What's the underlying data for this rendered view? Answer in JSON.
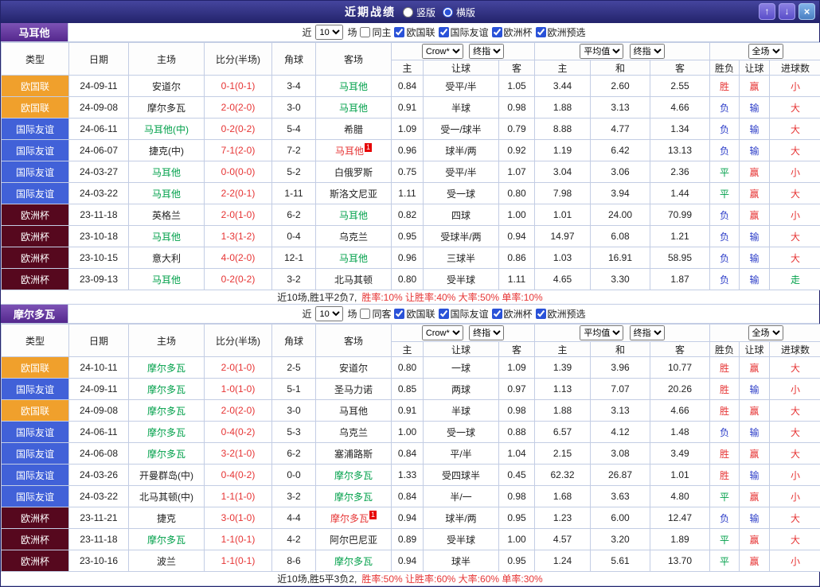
{
  "titlebar": {
    "title": "近期战绩",
    "layout_options": [
      {
        "label": "竖版",
        "selected": false
      },
      {
        "label": "横版",
        "selected": true
      }
    ],
    "up_icon": "↑",
    "down_icon": "↓",
    "close_icon": "×"
  },
  "table_header": {
    "type": "类型",
    "date": "日期",
    "home": "主场",
    "score": "比分(半场)",
    "corner": "角球",
    "away": "客场",
    "company": "Crow*",
    "final_index": "终指",
    "average": "平均值",
    "full_match": "全场",
    "sub": {
      "h": "主",
      "handicap": "让球",
      "a": "客",
      "avg_h": "主",
      "avg_d": "和",
      "avg_a": "客",
      "wdl": "胜负",
      "cover": "让球",
      "goals": "进球数"
    }
  },
  "league_colors": {
    "欧国联": "#f0a02c",
    "国际友谊": "#4161d8",
    "欧洲杯": "#56081e"
  },
  "sections": [
    {
      "team": "马耳他",
      "filter": {
        "prefix": "近",
        "count": "10",
        "suffix": "场",
        "venue": {
          "label": "同主",
          "checked": false
        },
        "leagues": [
          {
            "label": "欧国联",
            "checked": true
          },
          {
            "label": "国际友谊",
            "checked": true
          },
          {
            "label": "欧洲杯",
            "checked": true
          },
          {
            "label": "欧洲预选",
            "checked": true
          }
        ]
      },
      "rows": [
        {
          "type": "欧国联",
          "date": "24-09-11",
          "home": "安道尔",
          "score": "0-1(0-1)",
          "corner": "3-4",
          "away": "马耳他",
          "away_cls": "green",
          "h_odds": "0.84",
          "handicap": "受平/半",
          "a_odds": "1.05",
          "avg_h": "3.44",
          "avg_d": "2.60",
          "avg_a": "2.55",
          "wdl": "胜",
          "wdl_cls": "red",
          "cover": "赢",
          "cover_cls": "red",
          "ou": "小",
          "ou_cls": "red"
        },
        {
          "type": "欧国联",
          "date": "24-09-08",
          "home": "摩尔多瓦",
          "score": "2-0(2-0)",
          "corner": "3-0",
          "away": "马耳他",
          "away_cls": "green",
          "h_odds": "0.91",
          "handicap": "半球",
          "a_odds": "0.98",
          "avg_h": "1.88",
          "avg_d": "3.13",
          "avg_a": "4.66",
          "wdl": "负",
          "wdl_cls": "blue",
          "cover": "输",
          "cover_cls": "blue",
          "ou": "大",
          "ou_cls": "red"
        },
        {
          "type": "国际友谊",
          "date": "24-06-11",
          "home": "马耳他(中)",
          "home_cls": "green",
          "score": "0-2(0-2)",
          "corner": "5-4",
          "away": "希腊",
          "h_odds": "1.09",
          "handicap": "受一/球半",
          "a_odds": "0.79",
          "avg_h": "8.88",
          "avg_d": "4.77",
          "avg_a": "1.34",
          "wdl": "负",
          "wdl_cls": "blue",
          "cover": "输",
          "cover_cls": "blue",
          "ou": "大",
          "ou_cls": "red"
        },
        {
          "type": "国际友谊",
          "date": "24-06-07",
          "home": "捷克(中)",
          "score": "7-1(2-0)",
          "corner": "7-2",
          "away": "马耳他",
          "away_cls": "redteam",
          "away_badge": "1",
          "h_odds": "0.96",
          "handicap": "球半/两",
          "a_odds": "0.92",
          "avg_h": "1.19",
          "avg_d": "6.42",
          "avg_a": "13.13",
          "wdl": "负",
          "wdl_cls": "blue",
          "cover": "输",
          "cover_cls": "blue",
          "ou": "大",
          "ou_cls": "red"
        },
        {
          "type": "国际友谊",
          "date": "24-03-27",
          "home": "马耳他",
          "home_cls": "green",
          "score": "0-0(0-0)",
          "corner": "5-2",
          "away": "白俄罗斯",
          "h_odds": "0.75",
          "handicap": "受平/半",
          "a_odds": "1.07",
          "avg_h": "3.04",
          "avg_d": "3.06",
          "avg_a": "2.36",
          "wdl": "平",
          "wdl_cls": "green",
          "cover": "赢",
          "cover_cls": "red",
          "ou": "小",
          "ou_cls": "red"
        },
        {
          "type": "国际友谊",
          "date": "24-03-22",
          "home": "马耳他",
          "home_cls": "green",
          "score": "2-2(0-1)",
          "corner": "1-11",
          "away": "斯洛文尼亚",
          "h_odds": "1.11",
          "handicap": "受一球",
          "a_odds": "0.80",
          "avg_h": "7.98",
          "avg_d": "3.94",
          "avg_a": "1.44",
          "wdl": "平",
          "wdl_cls": "green",
          "cover": "赢",
          "cover_cls": "red",
          "ou": "大",
          "ou_cls": "red"
        },
        {
          "type": "欧洲杯",
          "date": "23-11-18",
          "home": "英格兰",
          "score": "2-0(1-0)",
          "corner": "6-2",
          "away": "马耳他",
          "away_cls": "green",
          "h_odds": "0.82",
          "handicap": "四球",
          "a_odds": "1.00",
          "avg_h": "1.01",
          "avg_d": "24.00",
          "avg_a": "70.99",
          "wdl": "负",
          "wdl_cls": "blue",
          "cover": "赢",
          "cover_cls": "red",
          "ou": "小",
          "ou_cls": "red"
        },
        {
          "type": "欧洲杯",
          "date": "23-10-18",
          "home": "马耳他",
          "home_cls": "green",
          "score": "1-3(1-2)",
          "corner": "0-4",
          "away": "乌克兰",
          "h_odds": "0.95",
          "handicap": "受球半/两",
          "a_odds": "0.94",
          "avg_h": "14.97",
          "avg_d": "6.08",
          "avg_a": "1.21",
          "wdl": "负",
          "wdl_cls": "blue",
          "cover": "输",
          "cover_cls": "blue",
          "ou": "大",
          "ou_cls": "red"
        },
        {
          "type": "欧洲杯",
          "date": "23-10-15",
          "home": "意大利",
          "score": "4-0(2-0)",
          "corner": "12-1",
          "away": "马耳他",
          "away_cls": "green",
          "h_odds": "0.96",
          "handicap": "三球半",
          "a_odds": "0.86",
          "avg_h": "1.03",
          "avg_d": "16.91",
          "avg_a": "58.95",
          "wdl": "负",
          "wdl_cls": "blue",
          "cover": "输",
          "cover_cls": "blue",
          "ou": "大",
          "ou_cls": "red"
        },
        {
          "type": "欧洲杯",
          "date": "23-09-13",
          "home": "马耳他",
          "home_cls": "green",
          "score": "0-2(0-2)",
          "corner": "3-2",
          "away": "北马其顿",
          "h_odds": "0.80",
          "handicap": "受半球",
          "a_odds": "1.11",
          "avg_h": "4.65",
          "avg_d": "3.30",
          "avg_a": "1.87",
          "wdl": "负",
          "wdl_cls": "blue",
          "cover": "输",
          "cover_cls": "blue",
          "ou": "走",
          "ou_cls": "green"
        }
      ],
      "footer": {
        "summary": "近10场,胜1平2负7,",
        "stats": "胜率:10% 让胜率:40% 大率:50% 单率:10%"
      }
    },
    {
      "team": "摩尔多瓦",
      "filter": {
        "prefix": "近",
        "count": "10",
        "suffix": "场",
        "venue": {
          "label": "同客",
          "checked": false
        },
        "leagues": [
          {
            "label": "欧国联",
            "checked": true
          },
          {
            "label": "国际友谊",
            "checked": true
          },
          {
            "label": "欧洲杯",
            "checked": true
          },
          {
            "label": "欧洲预选",
            "checked": true
          }
        ]
      },
      "rows": [
        {
          "type": "欧国联",
          "date": "24-10-11",
          "home": "摩尔多瓦",
          "home_cls": "green",
          "score": "2-0(1-0)",
          "corner": "2-5",
          "away": "安道尔",
          "h_odds": "0.80",
          "handicap": "一球",
          "a_odds": "1.09",
          "avg_h": "1.39",
          "avg_d": "3.96",
          "avg_a": "10.77",
          "wdl": "胜",
          "wdl_cls": "red",
          "cover": "赢",
          "cover_cls": "red",
          "ou": "大",
          "ou_cls": "red"
        },
        {
          "type": "国际友谊",
          "date": "24-09-11",
          "home": "摩尔多瓦",
          "home_cls": "green",
          "score": "1-0(1-0)",
          "corner": "5-1",
          "away": "圣马力诺",
          "h_odds": "0.85",
          "handicap": "两球",
          "a_odds": "0.97",
          "avg_h": "1.13",
          "avg_d": "7.07",
          "avg_a": "20.26",
          "wdl": "胜",
          "wdl_cls": "red",
          "cover": "输",
          "cover_cls": "blue",
          "ou": "小",
          "ou_cls": "red"
        },
        {
          "type": "欧国联",
          "date": "24-09-08",
          "home": "摩尔多瓦",
          "home_cls": "green",
          "score": "2-0(2-0)",
          "corner": "3-0",
          "away": "马耳他",
          "h_odds": "0.91",
          "handicap": "半球",
          "a_odds": "0.98",
          "avg_h": "1.88",
          "avg_d": "3.13",
          "avg_a": "4.66",
          "wdl": "胜",
          "wdl_cls": "red",
          "cover": "赢",
          "cover_cls": "red",
          "ou": "大",
          "ou_cls": "red"
        },
        {
          "type": "国际友谊",
          "date": "24-06-11",
          "home": "摩尔多瓦",
          "home_cls": "green",
          "score": "0-4(0-2)",
          "corner": "5-3",
          "away": "乌克兰",
          "h_odds": "1.00",
          "handicap": "受一球",
          "a_odds": "0.88",
          "avg_h": "6.57",
          "avg_d": "4.12",
          "avg_a": "1.48",
          "wdl": "负",
          "wdl_cls": "blue",
          "cover": "输",
          "cover_cls": "blue",
          "ou": "大",
          "ou_cls": "red"
        },
        {
          "type": "国际友谊",
          "date": "24-06-08",
          "home": "摩尔多瓦",
          "home_cls": "green",
          "score": "3-2(1-0)",
          "corner": "6-2",
          "away": "塞浦路斯",
          "h_odds": "0.84",
          "handicap": "平/半",
          "a_odds": "1.04",
          "avg_h": "2.15",
          "avg_d": "3.08",
          "avg_a": "3.49",
          "wdl": "胜",
          "wdl_cls": "red",
          "cover": "赢",
          "cover_cls": "red",
          "ou": "大",
          "ou_cls": "red"
        },
        {
          "type": "国际友谊",
          "date": "24-03-26",
          "home": "开曼群岛(中)",
          "score": "0-4(0-2)",
          "corner": "0-0",
          "away": "摩尔多瓦",
          "away_cls": "green",
          "h_odds": "1.33",
          "handicap": "受四球半",
          "a_odds": "0.45",
          "avg_h": "62.32",
          "avg_d": "26.87",
          "avg_a": "1.01",
          "wdl": "胜",
          "wdl_cls": "red",
          "cover": "输",
          "cover_cls": "blue",
          "ou": "小",
          "ou_cls": "red"
        },
        {
          "type": "国际友谊",
          "date": "24-03-22",
          "home": "北马其顿(中)",
          "score": "1-1(1-0)",
          "corner": "3-2",
          "away": "摩尔多瓦",
          "away_cls": "green",
          "h_odds": "0.84",
          "handicap": "半/一",
          "a_odds": "0.98",
          "avg_h": "1.68",
          "avg_d": "3.63",
          "avg_a": "4.80",
          "wdl": "平",
          "wdl_cls": "green",
          "cover": "赢",
          "cover_cls": "red",
          "ou": "小",
          "ou_cls": "red"
        },
        {
          "type": "欧洲杯",
          "date": "23-11-21",
          "home": "捷克",
          "score": "3-0(1-0)",
          "corner": "4-4",
          "away": "摩尔多瓦",
          "away_cls": "redteam",
          "away_badge": "1",
          "h_odds": "0.94",
          "handicap": "球半/两",
          "a_odds": "0.95",
          "avg_h": "1.23",
          "avg_d": "6.00",
          "avg_a": "12.47",
          "wdl": "负",
          "wdl_cls": "blue",
          "cover": "输",
          "cover_cls": "blue",
          "ou": "大",
          "ou_cls": "red"
        },
        {
          "type": "欧洲杯",
          "date": "23-11-18",
          "home": "摩尔多瓦",
          "home_cls": "green",
          "score": "1-1(0-1)",
          "corner": "4-2",
          "away": "阿尔巴尼亚",
          "h_odds": "0.89",
          "handicap": "受半球",
          "a_odds": "1.00",
          "avg_h": "4.57",
          "avg_d": "3.20",
          "avg_a": "1.89",
          "wdl": "平",
          "wdl_cls": "green",
          "cover": "赢",
          "cover_cls": "red",
          "ou": "大",
          "ou_cls": "red"
        },
        {
          "type": "欧洲杯",
          "date": "23-10-16",
          "home": "波兰",
          "score": "1-1(0-1)",
          "corner": "8-6",
          "away": "摩尔多瓦",
          "away_cls": "green",
          "h_odds": "0.94",
          "handicap": "球半",
          "a_odds": "0.95",
          "avg_h": "1.24",
          "avg_d": "5.61",
          "avg_a": "13.70",
          "wdl": "平",
          "wdl_cls": "green",
          "cover": "赢",
          "cover_cls": "red",
          "ou": "小",
          "ou_cls": "red"
        }
      ],
      "footer": {
        "summary": "近10场,胜5平3负2,",
        "stats": "胜率:50% 让胜率:60% 大率:60% 单率:30%"
      }
    }
  ]
}
